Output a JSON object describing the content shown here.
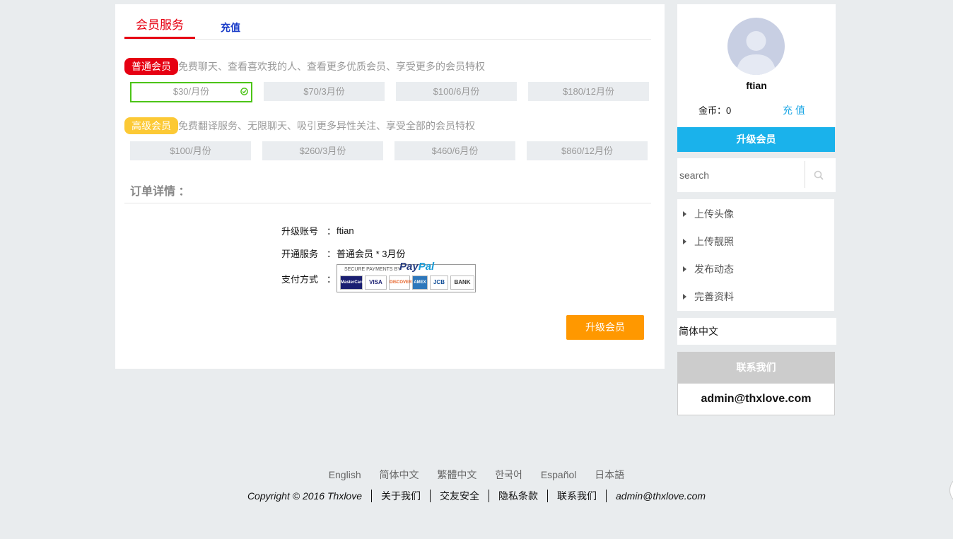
{
  "tabs": {
    "active": "会员服务",
    "recharge": "充值"
  },
  "tiers": {
    "normal": {
      "badge": "普通会员",
      "desc": "免费聊天、查看喜欢我的人、查看更多优质会员、享受更多的会员特权",
      "prices": [
        "$30/月份",
        "$70/3月份",
        "$100/6月份",
        "$180/12月份"
      ],
      "selected_index": 0
    },
    "premium": {
      "badge": "高级会员",
      "desc": "免费翻译服务、无限聊天、吸引更多异性关注、享受全部的会员特权",
      "prices": [
        "$100/月份",
        "$260/3月份",
        "$460/6月份",
        "$860/12月份"
      ]
    }
  },
  "order": {
    "title": "订单详情 ：",
    "account_label": "升级账号",
    "account_value": "ftian",
    "service_label": "开通服务",
    "service_value": "普通会员 * 3月份",
    "payment_label": "支付方式",
    "sep": "：",
    "paypal": {
      "tagline": "SECURE PAYMENTS BY",
      "logo_a": "Pay",
      "logo_b": "Pal",
      "cards": [
        "MasterCard",
        "VISA",
        "DISCOVER",
        "AMEX",
        "JCB",
        "BANK"
      ]
    },
    "submit_label": "升级会员"
  },
  "sidebar": {
    "username": "ftian",
    "coins": "金币：0",
    "recharge": "充 值",
    "upgrade": "升级会员",
    "search_placeholder": "search",
    "menu": [
      "上传头像",
      "上传靓照",
      "发布动态",
      "完善资料"
    ],
    "language": "简体中文",
    "contact_title": "联系我们",
    "contact_email": "admin@thxlove.com"
  },
  "footer": {
    "languages": [
      "English",
      "简体中文",
      "繁體中文",
      "한국어",
      "Español",
      "日本語"
    ],
    "copyright": "Copyright © 2016 Thxlove",
    "links": [
      "关于我们",
      "交友安全",
      "隐私条款",
      "联系我们"
    ],
    "email": "admin@thxlove.com"
  },
  "colors": {
    "accent_red": "#e60012",
    "accent_blue": "#1ab2eb",
    "accent_orange": "#ff9800",
    "premium_yellow": "#fcc935",
    "selected_green": "#4cc417"
  }
}
